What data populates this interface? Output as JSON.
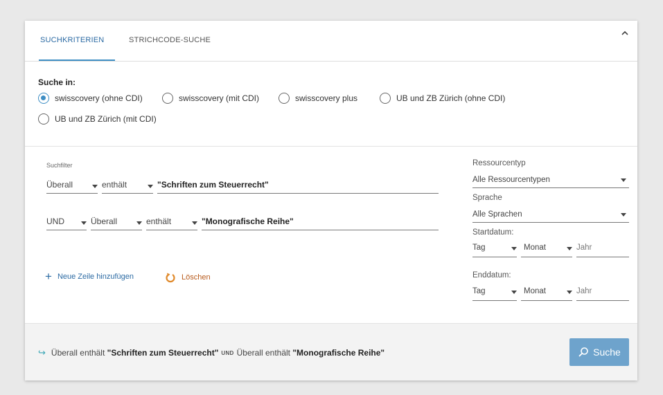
{
  "tabs": [
    "SUCHKRITERIEN",
    "STRICHCODE-SUCHE"
  ],
  "search_in": {
    "label": "Suche in:",
    "options": [
      {
        "label": "swisscovery (ohne CDI)",
        "selected": true
      },
      {
        "label": "swisscovery (mit CDI)",
        "selected": false
      },
      {
        "label": "swisscovery plus",
        "selected": false
      },
      {
        "label": "UB und ZB Zürich (ohne CDI)",
        "selected": false
      },
      {
        "label": "UB und ZB Zürich (mit CDI)",
        "selected": false
      }
    ]
  },
  "filters": {
    "label": "Suchfilter",
    "row1": {
      "field": "Überall",
      "operator": "enthält",
      "value": "\"Schriften zum Steuerrecht\""
    },
    "row2": {
      "boolean": "UND",
      "field": "Überall",
      "operator": "enthält",
      "value": "\"Monografische Reihe\""
    },
    "add_row": "Neue Zeile hinzufügen",
    "clear": "Löschen"
  },
  "side": {
    "resource_label": "Ressourcentyp",
    "resource_value": "Alle Ressourcentypen",
    "language_label": "Sprache",
    "language_value": "Alle Sprachen",
    "start_label": "Startdatum:",
    "end_label": "Enddatum:",
    "day": "Tag",
    "month": "Monat",
    "year": "Jahr"
  },
  "summary": {
    "part1_field": "Überall",
    "part1_op": "enthält",
    "part1_value": "\"Schriften zum Steuerrecht\"",
    "bool": "UND",
    "part2_field": "Überall",
    "part2_op": "enthält",
    "part2_value": "\"Monografische Reihe\""
  },
  "search_button": "Suche",
  "colors": {
    "accent": "#3e8ec4",
    "button": "#6ea3cc",
    "clear": "#b85a1b"
  }
}
